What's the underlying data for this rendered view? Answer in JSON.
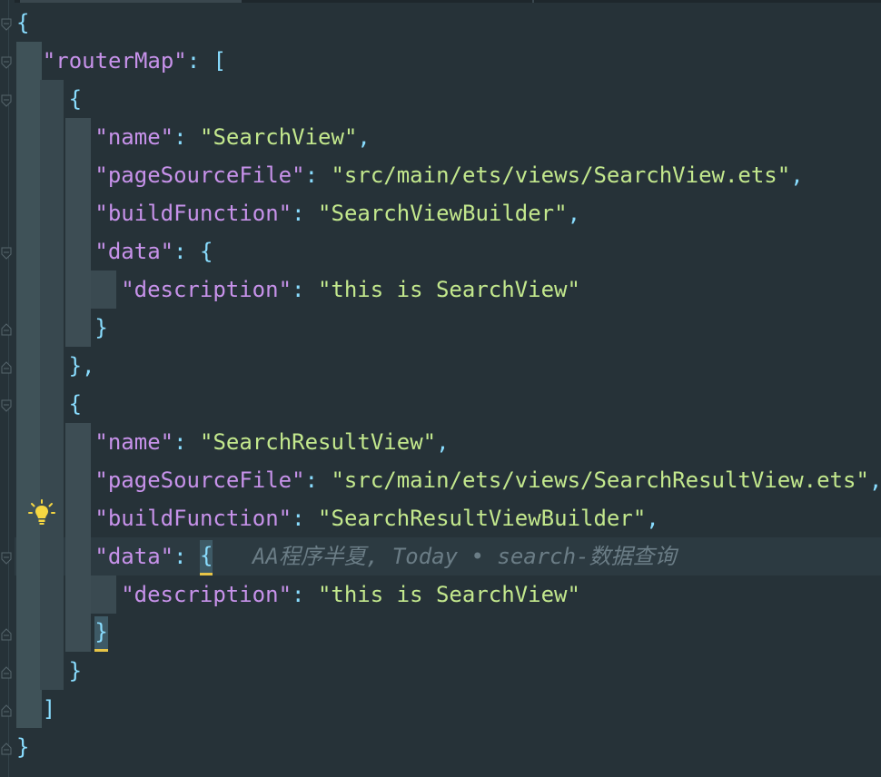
{
  "editor": {
    "lines": [
      {
        "indent": "",
        "parts": [
          {
            "t": "{",
            "c": "punc"
          }
        ]
      },
      {
        "indent": "  ",
        "parts": [
          {
            "t": "\"routerMap\"",
            "c": "key"
          },
          {
            "t": ": [",
            "c": "punc"
          }
        ]
      },
      {
        "indent": "    ",
        "parts": [
          {
            "t": "{",
            "c": "punc"
          }
        ]
      },
      {
        "indent": "      ",
        "parts": [
          {
            "t": "\"name\"",
            "c": "key"
          },
          {
            "t": ": ",
            "c": "punc"
          },
          {
            "t": "\"SearchView\"",
            "c": "str"
          },
          {
            "t": ",",
            "c": "punc"
          }
        ]
      },
      {
        "indent": "      ",
        "parts": [
          {
            "t": "\"pageSourceFile\"",
            "c": "key"
          },
          {
            "t": ": ",
            "c": "punc"
          },
          {
            "t": "\"src/main/ets/views/SearchView.ets\"",
            "c": "str"
          },
          {
            "t": ",",
            "c": "punc"
          }
        ]
      },
      {
        "indent": "      ",
        "parts": [
          {
            "t": "\"buildFunction\"",
            "c": "key"
          },
          {
            "t": ": ",
            "c": "punc"
          },
          {
            "t": "\"SearchViewBuilder\"",
            "c": "str"
          },
          {
            "t": ",",
            "c": "punc"
          }
        ]
      },
      {
        "indent": "      ",
        "parts": [
          {
            "t": "\"data\"",
            "c": "key"
          },
          {
            "t": ": {",
            "c": "punc"
          }
        ]
      },
      {
        "indent": "        ",
        "parts": [
          {
            "t": "\"description\"",
            "c": "key"
          },
          {
            "t": ": ",
            "c": "punc"
          },
          {
            "t": "\"this is SearchView\"",
            "c": "str"
          }
        ]
      },
      {
        "indent": "      ",
        "parts": [
          {
            "t": "}",
            "c": "punc"
          }
        ]
      },
      {
        "indent": "    ",
        "parts": [
          {
            "t": "},",
            "c": "punc"
          }
        ]
      },
      {
        "indent": "    ",
        "parts": [
          {
            "t": "{",
            "c": "punc"
          }
        ]
      },
      {
        "indent": "      ",
        "parts": [
          {
            "t": "\"name\"",
            "c": "key"
          },
          {
            "t": ": ",
            "c": "punc"
          },
          {
            "t": "\"SearchResultView\"",
            "c": "str"
          },
          {
            "t": ",",
            "c": "punc"
          }
        ]
      },
      {
        "indent": "      ",
        "parts": [
          {
            "t": "\"pageSourceFile\"",
            "c": "key"
          },
          {
            "t": ": ",
            "c": "punc"
          },
          {
            "t": "\"src/main/ets/views/SearchResultView.ets\"",
            "c": "str"
          },
          {
            "t": ",",
            "c": "punc"
          }
        ]
      },
      {
        "indent": "      ",
        "parts": [
          {
            "t": "\"buildFunction\"",
            "c": "key"
          },
          {
            "t": ": ",
            "c": "punc"
          },
          {
            "t": "\"SearchResultViewBuilder\"",
            "c": "str"
          },
          {
            "t": ",",
            "c": "punc"
          }
        ]
      },
      {
        "indent": "      ",
        "parts": [
          {
            "t": "\"data\"",
            "c": "key"
          },
          {
            "t": ": ",
            "c": "punc"
          },
          {
            "t": "{",
            "c": "punc",
            "hl": true
          }
        ]
      },
      {
        "indent": "        ",
        "parts": [
          {
            "t": "\"description\"",
            "c": "key"
          },
          {
            "t": ": ",
            "c": "punc"
          },
          {
            "t": "\"this is SearchView\"",
            "c": "str"
          }
        ]
      },
      {
        "indent": "      ",
        "parts": [
          {
            "t": "}",
            "c": "punc",
            "hl": true
          }
        ]
      },
      {
        "indent": "    ",
        "parts": [
          {
            "t": "}",
            "c": "punc"
          }
        ]
      },
      {
        "indent": "  ",
        "parts": [
          {
            "t": "]",
            "c": "punc"
          }
        ]
      },
      {
        "indent": "",
        "parts": [
          {
            "t": "}",
            "c": "punc"
          }
        ]
      }
    ],
    "blame_annotation": "AA程序半夏, Today • search-数据查询",
    "intention_icon": "lightbulb-icon"
  },
  "colors": {
    "background": "#263238",
    "key": "#c792ea",
    "string": "#c3e88d",
    "punctuation": "#89ddff",
    "annotation": "#6b7d86",
    "bulb": "#f5d742"
  }
}
